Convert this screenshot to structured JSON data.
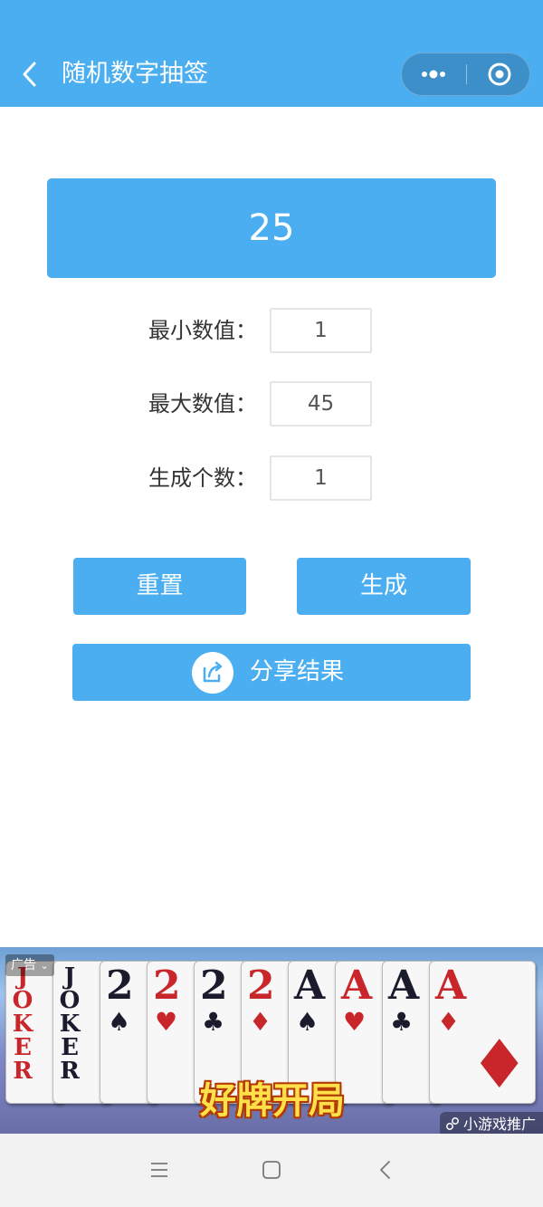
{
  "header": {
    "title": "随机数字抽签",
    "background_color": "#4aaef0",
    "back_icon": "chevron-left-icon",
    "more_icon": "more-dots-icon",
    "close_icon": "target-circle-icon"
  },
  "result": {
    "value": "25"
  },
  "form": {
    "min": {
      "label": "最小数值：",
      "value": "1"
    },
    "max": {
      "label": "最大数值：",
      "value": "45"
    },
    "count": {
      "label": "生成个数：",
      "value": "1"
    }
  },
  "buttons": {
    "reset": "重置",
    "generate": "生成",
    "share": "分享结果",
    "share_icon": "share-arrow-icon",
    "color": "#4aaef0"
  },
  "ad": {
    "tag": "广告",
    "slogan": "好牌开局",
    "source": "小游戏推广",
    "cards": [
      {
        "rank": "JOKER",
        "suit": "",
        "color": "red"
      },
      {
        "rank": "JOKER",
        "suit": "",
        "color": "black"
      },
      {
        "rank": "2",
        "suit": "♠",
        "color": "black"
      },
      {
        "rank": "2",
        "suit": "♥",
        "color": "red"
      },
      {
        "rank": "2",
        "suit": "♣",
        "color": "black"
      },
      {
        "rank": "2",
        "suit": "♦",
        "color": "red"
      },
      {
        "rank": "A",
        "suit": "♠",
        "color": "black"
      },
      {
        "rank": "A",
        "suit": "♥",
        "color": "red"
      },
      {
        "rank": "A",
        "suit": "♣",
        "color": "black"
      },
      {
        "rank": "A",
        "suit": "♦",
        "color": "red"
      }
    ]
  },
  "system_nav": {
    "menu_icon": "menu-lines-icon",
    "home_icon": "square-home-icon",
    "back_icon": "chevron-left-icon"
  }
}
